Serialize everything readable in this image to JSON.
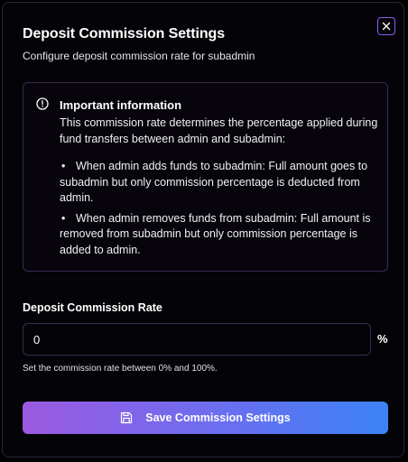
{
  "dialog": {
    "title": "Deposit Commission Settings",
    "subtitle": "Configure deposit commission rate for subadmin",
    "close_icon": "close-icon"
  },
  "info": {
    "icon": "alert-circle-icon",
    "heading": "Important information",
    "description": "This commission rate determines the percentage applied during fund transfers between admin and subadmin:",
    "bullets": [
      "When admin adds funds to subadmin: Full amount goes to subadmin but only commission percentage is deducted from admin.",
      "When admin removes funds from subadmin: Full amount is removed from subadmin but only commission percentage is added to admin."
    ]
  },
  "form": {
    "label": "Deposit Commission Rate",
    "value": "0",
    "unit": "%",
    "helper": "Set the commission rate between 0% and 100%."
  },
  "actions": {
    "save_label": "Save Commission Settings",
    "save_icon": "save-icon"
  },
  "colors": {
    "accent": "#8b5cf6",
    "gradient_start": "#9b59e0",
    "gradient_end": "#3b82f6",
    "border": "#3a2b55"
  }
}
